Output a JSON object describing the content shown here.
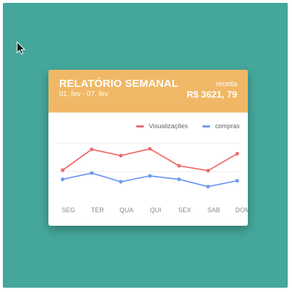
{
  "card": {
    "title": "RELATÓRIO SEMANAL",
    "date_range": "01. fev - 07. fev",
    "revenue_label": "receita",
    "revenue_value": "R$ 3621, 79"
  },
  "colors": {
    "background": "#45a79b",
    "header": "#f0b866",
    "series_views": "#ef6b6b",
    "series_purchases": "#6f9af0"
  },
  "chart_data": {
    "type": "line",
    "categories": [
      "SEG",
      "TER",
      "QUA",
      "QUI",
      "SEX",
      "SAB",
      "DOM"
    ],
    "series": [
      {
        "name": "Visualizações",
        "color": "#ef6b6b",
        "values": [
          6.5,
          10.8,
          9.5,
          10.9,
          7.4,
          6.4,
          9.9
        ]
      },
      {
        "name": "compras",
        "color": "#6f9af0",
        "values": [
          4.6,
          5.9,
          4.1,
          5.3,
          4.6,
          3.1,
          4.3
        ]
      }
    ],
    "ylim": [
      0,
      14
    ],
    "grid": true,
    "legend": "top-right"
  }
}
